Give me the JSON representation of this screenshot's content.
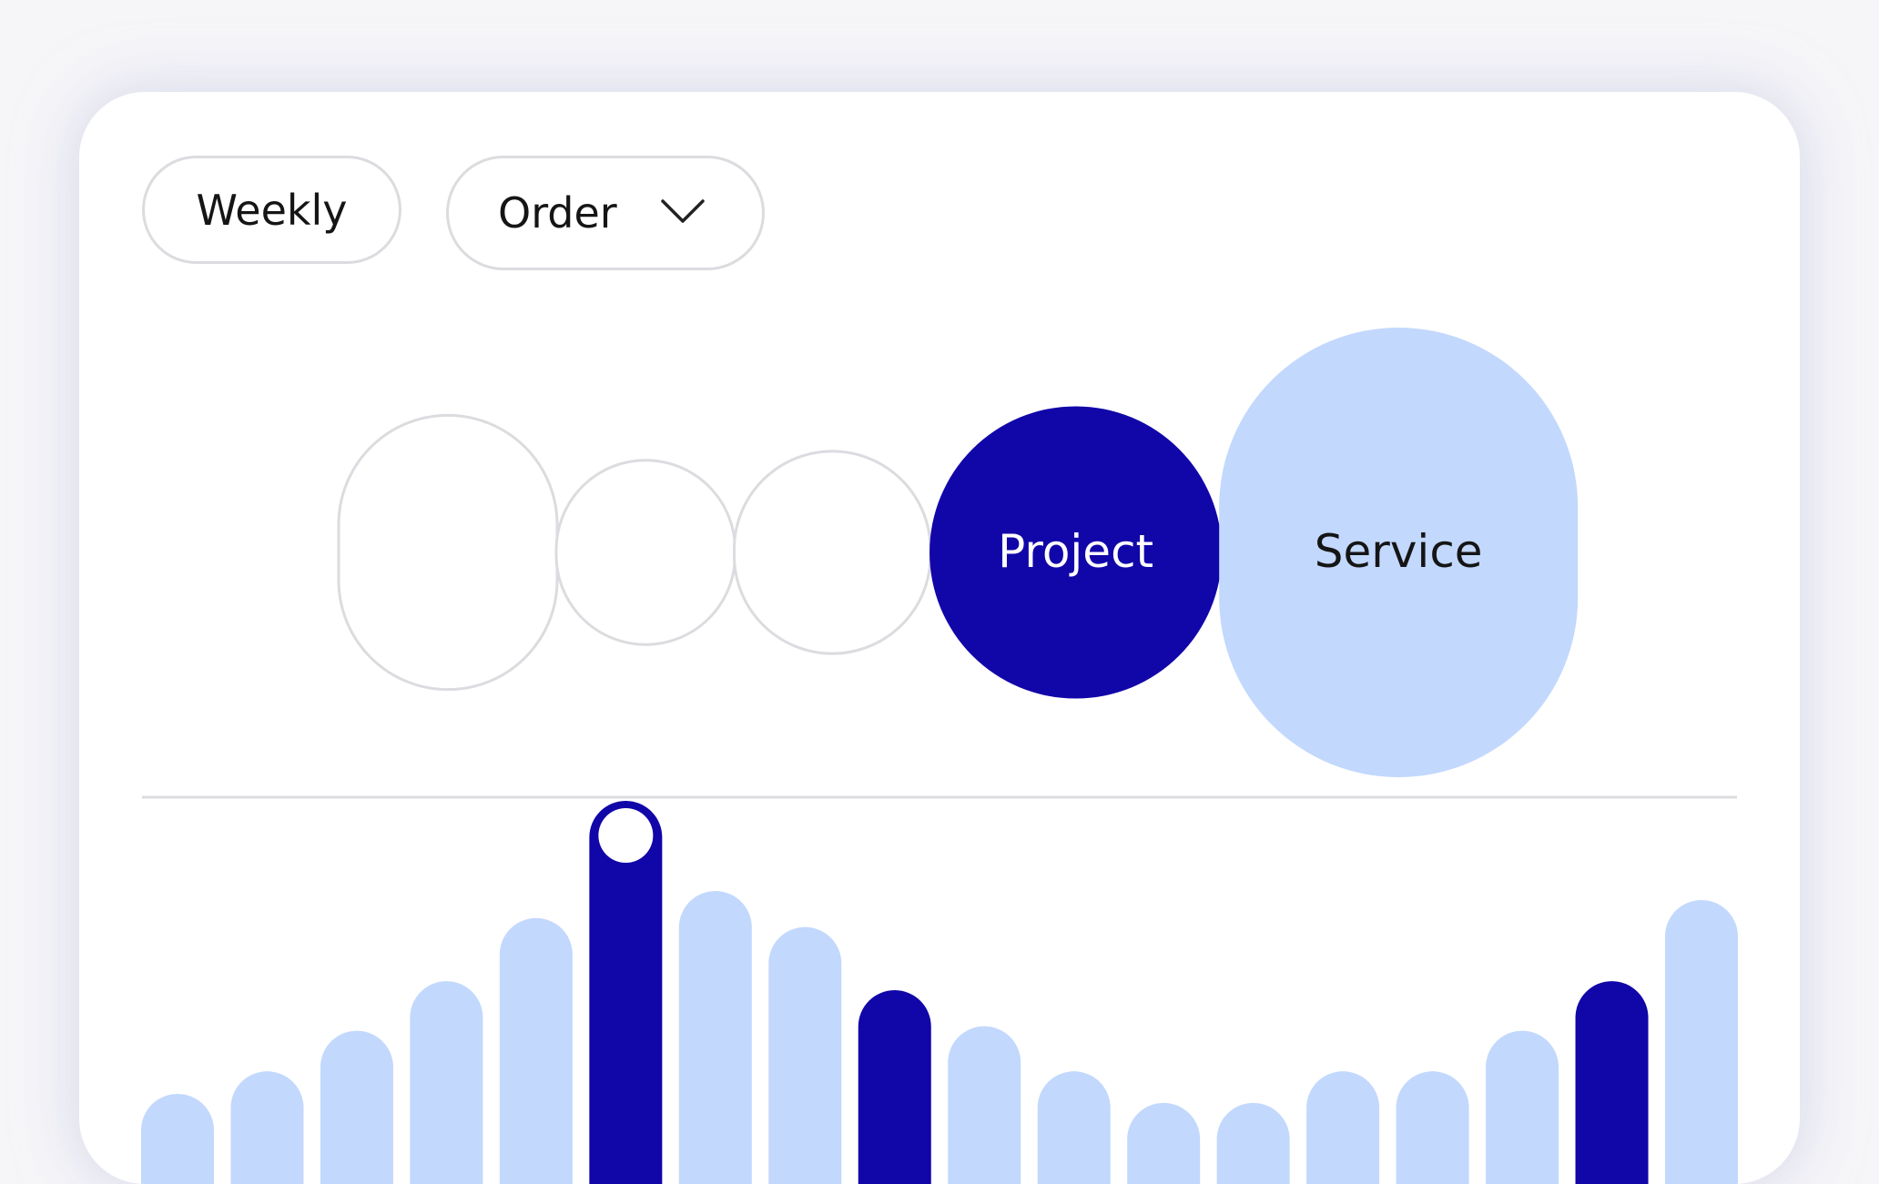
{
  "colors": {
    "accent": "#1106a8",
    "light": "#c2d8fd",
    "outline": "#dcdce0",
    "background": "#f6f6f9"
  },
  "controls": {
    "period_label": "Weekly",
    "sort_label": "Order",
    "sort_icon": "chevron-down-icon"
  },
  "chart_data": [
    {
      "type": "bubble",
      "items": [
        {
          "label": "",
          "size": 0.61,
          "style": "outline"
        },
        {
          "label": "",
          "size": 0.41,
          "style": "outline"
        },
        {
          "label": "",
          "size": 0.45,
          "style": "outline"
        },
        {
          "label": "Project",
          "size": 0.65,
          "style": "accent"
        },
        {
          "label": "Service",
          "size": 1.0,
          "style": "light"
        }
      ]
    },
    {
      "type": "bar",
      "values": [
        0.2,
        0.25,
        0.34,
        0.45,
        0.59,
        0.85,
        0.65,
        0.57,
        0.43,
        0.35,
        0.25,
        0.18,
        0.18,
        0.25,
        0.25,
        0.34,
        0.45,
        0.63
      ],
      "highlighted": [
        5,
        8,
        16
      ],
      "selected": 5,
      "grid": false
    }
  ]
}
